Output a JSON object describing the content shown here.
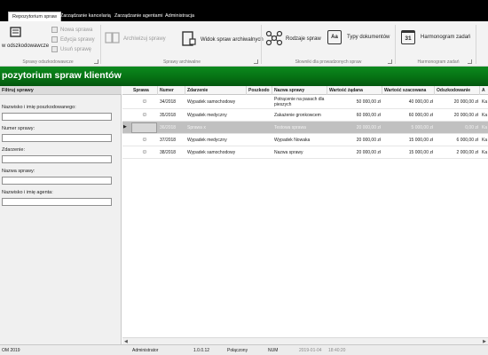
{
  "tabs": [
    {
      "label": "Repozytorium spraw",
      "active": true
    },
    {
      "label": "Zarządzanie kancelarią",
      "active": false
    },
    {
      "label": "Zarządzanie agentami",
      "active": false
    },
    {
      "label": "Administracja",
      "active": false
    }
  ],
  "ribbon": {
    "btn_odszkodowawcze": "w odszkodowawcze",
    "btn_nowa": "Nowa sprawa",
    "btn_edycja": "Edycja sprawy",
    "btn_usun": "Usuń sprawę",
    "btn_archiwizuj": "Archiwizuj sprawy",
    "btn_widok_arch": "Widok spraw archiwalnych",
    "btn_rodzaje": "Rodzaje spraw",
    "btn_typy": "Typy dokumentów",
    "btn_harmonogram": "Harmonogram zadań",
    "group_odszkodowawcze": "Sprawy odszkodowawcze",
    "group_archiwalne": "Sprawy archiwalne",
    "group_slowniki": "Słowniki dla prowadzonych spraw",
    "group_harmonogram": "Harmonogram zadań",
    "harmonogram_icon_text": "31",
    "typy_icon_text": "Aa"
  },
  "title": "pozytorium spraw klientów",
  "filter": {
    "header": "Filtruj sprawy",
    "fields": [
      {
        "label": "Nazwisko i imię poszkodowanego:",
        "value": ""
      },
      {
        "label": "Numer sprawy:",
        "value": ""
      },
      {
        "label": "Zdarzenie:",
        "value": ""
      },
      {
        "label": "Nazwa sprawy:",
        "value": ""
      },
      {
        "label": "Nazwisko i imię agenta:",
        "value": ""
      }
    ]
  },
  "grid": {
    "columns": [
      "Sprawa",
      "Numer",
      "Zdarzenie",
      "Poszkodo",
      "Nazwa sprawy",
      "Wartość żądana",
      "Wartość szacowana",
      "Odszkodowanie",
      "A"
    ],
    "rows": [
      {
        "sprawa": "☺",
        "numer": "34/2018",
        "zdarzenie": "Wypadek samochodowy",
        "poszkodo": "",
        "nazwa": "Potrącenie na pasach dla pieszych",
        "wart_zadana": "50 000,00 zł",
        "wart_szac": "40 000,00 zł",
        "odszk": "20 000,00 zł",
        "a": "Ka",
        "selected": false
      },
      {
        "sprawa": "☺",
        "numer": "35/2018",
        "zdarzenie": "Wypadek medyczny",
        "poszkodo": "",
        "nazwa": "Zakażenie gronkowcem",
        "wart_zadana": "60 000,00 zł",
        "wart_szac": "60 000,00 zł",
        "odszk": "20 000,00 zł",
        "a": "Ka",
        "selected": false
      },
      {
        "sprawa": "",
        "numer": "36/2018",
        "zdarzenie": "Sprawa x",
        "poszkodo": "",
        "nazwa": "Testowa sprawa",
        "wart_zadana": "20 000,00 zł",
        "wart_szac": "5 000,00 zł",
        "odszk": "0,00 zł",
        "a": "Ka",
        "selected": true
      },
      {
        "sprawa": "☺",
        "numer": "37/2018",
        "zdarzenie": "Wypadek medyczny",
        "poszkodo": "",
        "nazwa": "Wypadek Nowaka",
        "wart_zadana": "20 000,00 zł",
        "wart_szac": "15 000,00 zł",
        "odszk": "6 000,00 zł",
        "a": "Ka",
        "selected": false
      },
      {
        "sprawa": "☺",
        "numer": "38/2018",
        "zdarzenie": "Wypadek samochodowy",
        "poszkodo": "",
        "nazwa": "Nazwa sprawy",
        "wart_zadana": "20 000,00 zł",
        "wart_szac": "15 000,00 zł",
        "odszk": "2 000,00 zł",
        "a": "Ka",
        "selected": false
      }
    ]
  },
  "status": {
    "left": "OM 2019",
    "user": "Administrator",
    "version": "1.0.0.12",
    "connection": "Połączony",
    "num": "NUM",
    "date": "2019-01-04",
    "time": "18:40:20"
  },
  "colors": {
    "title_bar": "#067214",
    "tab_bar": "#000000"
  }
}
